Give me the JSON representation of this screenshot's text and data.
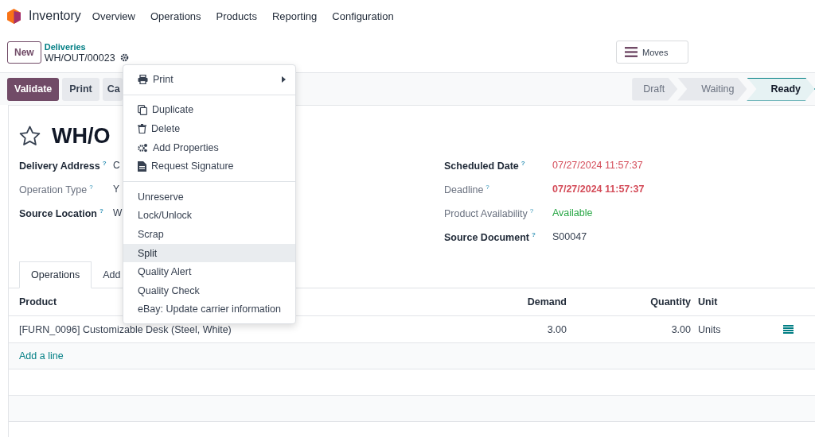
{
  "navbar": {
    "app_name": "Inventory",
    "menu": [
      "Overview",
      "Operations",
      "Products",
      "Reporting",
      "Configuration"
    ]
  },
  "control_panel": {
    "new_button": "New",
    "breadcrumb": "Deliveries",
    "record": "WH/OUT/00023",
    "moves_button": "Moves"
  },
  "actions": [
    {
      "label": "Validate",
      "kind": "primary"
    },
    {
      "label": "Print",
      "kind": "secondary"
    },
    {
      "label": "Ca",
      "kind": "secondary"
    }
  ],
  "stages": [
    {
      "label": "Draft",
      "selected": false
    },
    {
      "label": "Waiting",
      "selected": false
    },
    {
      "label": "Ready",
      "selected": true
    }
  ],
  "title": "WH/O",
  "fields_left": [
    {
      "label": "Delivery Address",
      "help": "?",
      "value": "C",
      "required": true
    },
    {
      "label": "Operation Type",
      "help": "?",
      "value": "Y",
      "required": false
    },
    {
      "label": "Source Location",
      "help": "?",
      "value": "W",
      "required": true
    }
  ],
  "fields_right": [
    {
      "label": "Scheduled Date",
      "help": "?",
      "value": "07/27/2024 11:57:37",
      "required": true,
      "kind": "overdue"
    },
    {
      "label": "Deadline",
      "help": "?",
      "value": "07/27/2024 11:57:37",
      "required": false,
      "kind": "deadline"
    },
    {
      "label": "Product Availability",
      "help": "?",
      "value": "Available",
      "required": false,
      "kind": "available"
    },
    {
      "label": "Source Document",
      "help": "?",
      "value": "S00047",
      "required": true
    }
  ],
  "tabs": [
    {
      "label": "Operations",
      "selected": true
    },
    {
      "label": "Add",
      "selected": false
    }
  ],
  "table": {
    "columns": [
      "Product",
      "Demand",
      "Quantity",
      "Unit"
    ],
    "rows": [
      {
        "product": "[FURN_0096] Customizable Desk (Steel, White)",
        "demand": "3.00",
        "quantity": "3.00",
        "unit": "Units"
      }
    ],
    "add_line": "Add a line"
  },
  "menu": {
    "groups": [
      [
        {
          "label": "Print",
          "kind": "printer",
          "submenu": true,
          "selected": false
        }
      ],
      [
        {
          "label": "Duplicate",
          "kind": "copy",
          "submenu": false,
          "selected": false
        },
        {
          "label": "Delete",
          "kind": "trash",
          "submenu": false,
          "selected": false
        },
        {
          "label": "Add Properties",
          "kind": "gears",
          "submenu": false,
          "selected": false
        },
        {
          "label": "Request Signature",
          "kind": "document",
          "submenu": false,
          "selected": false
        }
      ],
      [
        {
          "label": "Unreserve",
          "submenu": false,
          "selected": false
        },
        {
          "label": "Lock/Unlock",
          "submenu": false,
          "selected": false
        },
        {
          "label": "Scrap",
          "submenu": false,
          "selected": false
        },
        {
          "label": "Split",
          "submenu": false,
          "selected": true
        },
        {
          "label": "Quality Alert",
          "submenu": false,
          "selected": false
        },
        {
          "label": "Quality Check",
          "submenu": false,
          "selected": false
        },
        {
          "label": "eBay: Update carrier information",
          "submenu": false,
          "selected": false
        }
      ]
    ]
  }
}
